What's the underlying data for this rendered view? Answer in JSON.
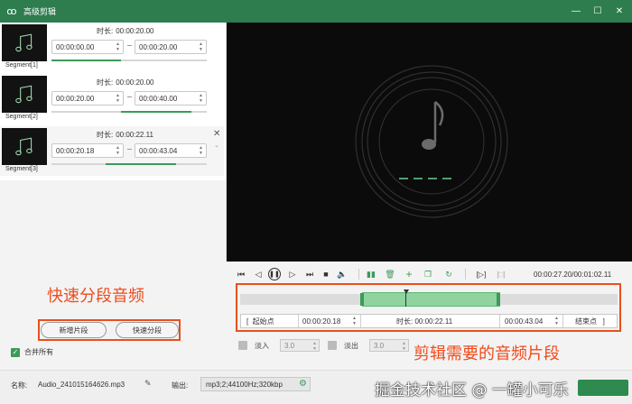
{
  "window": {
    "title": "高级剪辑"
  },
  "segments": [
    {
      "label": "Segment[1]",
      "duration_label": "时长:",
      "duration": "00:00:20.00",
      "start": "00:00:00.00",
      "end": "00:00:20.00",
      "range": [
        0.0,
        0.45
      ]
    },
    {
      "label": "Segment[2]",
      "duration_label": "时长:",
      "duration": "00:00:20.00",
      "start": "00:00:20.00",
      "end": "00:00:40.00",
      "range": [
        0.45,
        0.9
      ]
    },
    {
      "label": "Segment[3]",
      "duration_label": "时长:",
      "duration": "00:00:22.11",
      "start": "00:00:20.18",
      "end": "00:00:43.04",
      "range": [
        0.35,
        0.8
      ]
    }
  ],
  "buttons": {
    "add_segment": "新增片段",
    "quick_split": "快速分段",
    "merge_all": "合并所有"
  },
  "playback": {
    "time_readout": "00:00:27.20/00:01:02.11"
  },
  "trim": {
    "start_button": "起始点",
    "start_time": "00:00:20.18",
    "duration_label": "时长:",
    "duration": "00:00:22.11",
    "end_time": "00:00:43.04",
    "end_button": "结束点",
    "fade_in_label": "淡入",
    "fade_in_value": "3.0",
    "fade_out_label": "淡出",
    "fade_out_value": "3.0"
  },
  "annotations": {
    "left": "快速分段音频",
    "right": "剪辑需要的音频片段"
  },
  "bottom": {
    "name_label": "名称:",
    "file_name": "Audio_241015164626.mp3",
    "output_label": "输出:",
    "output_format": "mp3;2;44100Hz;320kbp"
  },
  "watermark": "掘金技术社区 @ 一罐小可乐",
  "colors": {
    "titlebar": "#2e7d4f",
    "accent": "#3c9a5a",
    "annotation": "#f04b1c"
  }
}
